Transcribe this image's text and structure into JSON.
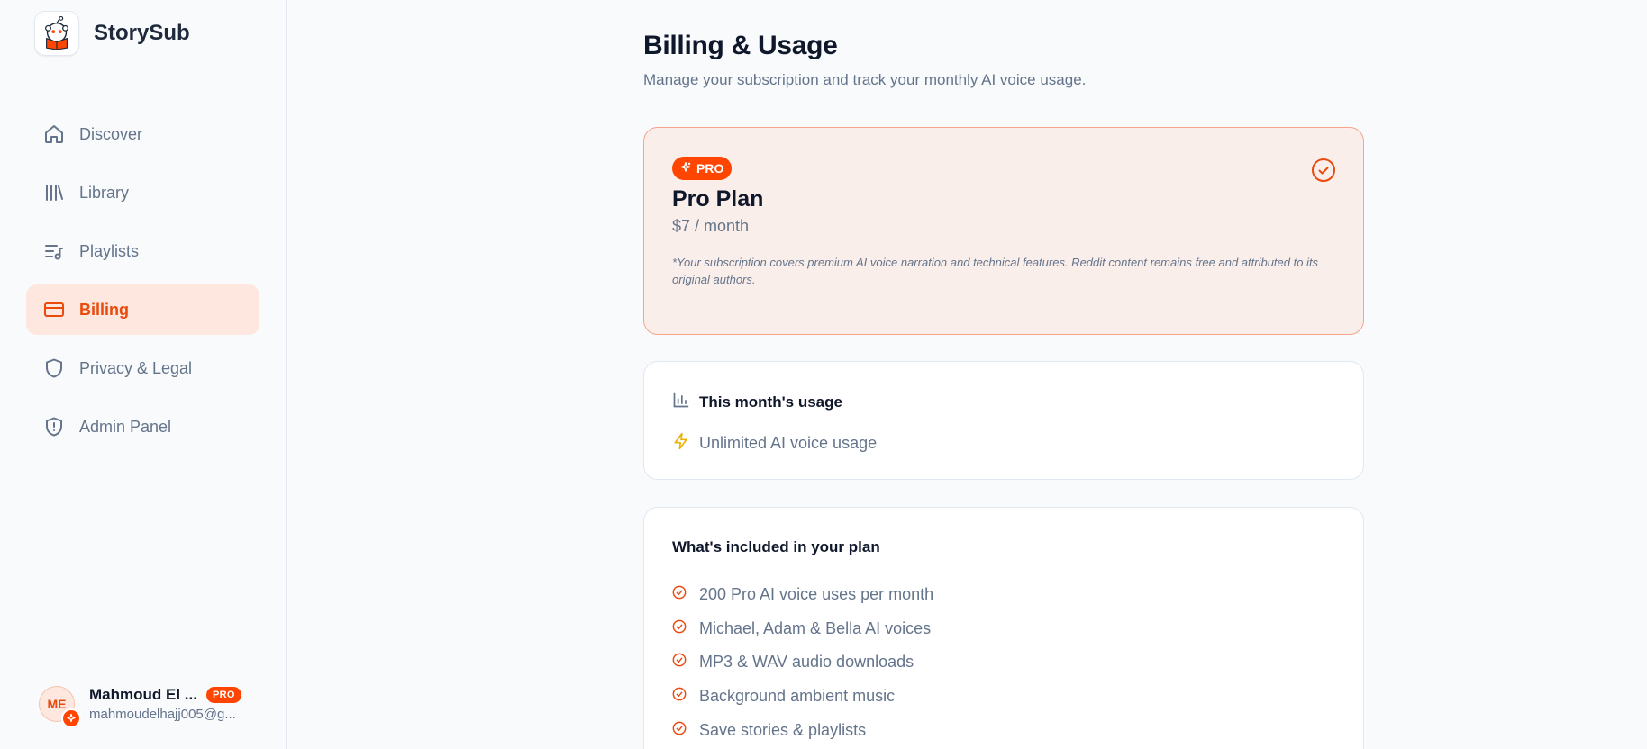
{
  "brand": {
    "name": "StorySub"
  },
  "nav": {
    "items": [
      {
        "label": "Discover"
      },
      {
        "label": "Library"
      },
      {
        "label": "Playlists"
      },
      {
        "label": "Billing"
      },
      {
        "label": "Privacy & Legal"
      },
      {
        "label": "Admin Panel"
      }
    ]
  },
  "user": {
    "initials": "ME",
    "name": "Mahmoud El ...",
    "badge": "PRO",
    "email": "mahmoudelhajj005@g..."
  },
  "page": {
    "title": "Billing & Usage",
    "subtitle": "Manage your subscription and track your monthly AI voice usage."
  },
  "plan": {
    "badge": "PRO",
    "name": "Pro Plan",
    "price": "$7 / month",
    "note": "*Your subscription covers premium AI voice narration and technical features. Reddit content remains free and attributed to its original authors."
  },
  "usage": {
    "title": "This month's usage",
    "value": "Unlimited AI voice usage"
  },
  "features": {
    "title": "What's included in your plan",
    "items": [
      "200 Pro AI voice uses per month",
      "Michael, Adam & Bella AI voices",
      "MP3 & WAV audio downloads",
      "Background ambient music",
      "Save stories & playlists"
    ]
  },
  "colors": {
    "accent": "#ff4500",
    "accent_text": "#ea4a0c",
    "muted": "#64748b",
    "usage_icon": "#eab308"
  }
}
